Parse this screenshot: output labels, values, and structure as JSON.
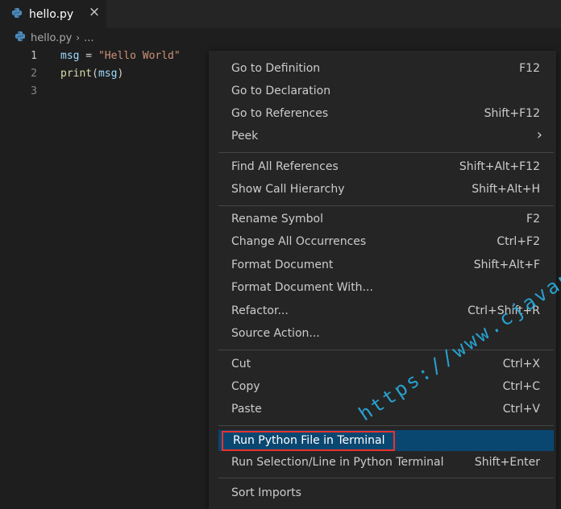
{
  "tab": {
    "filename": "hello.py",
    "close_icon": "×"
  },
  "breadcrumb": {
    "file": "hello.py",
    "separator": "›",
    "more": "..."
  },
  "editor": {
    "line_numbers": [
      "1",
      "2",
      "3"
    ],
    "line1": {
      "var": "msg",
      "op": " = ",
      "str": "\"Hello World\""
    },
    "line2": {
      "fn": "print",
      "open": "(",
      "var": "msg",
      "close": ")"
    }
  },
  "menu": {
    "go_to_definition": {
      "label": "Go to Definition",
      "shortcut": "F12"
    },
    "go_to_declaration": {
      "label": "Go to Declaration",
      "shortcut": ""
    },
    "go_to_references": {
      "label": "Go to References",
      "shortcut": "Shift+F12"
    },
    "peek": {
      "label": "Peek",
      "submenu_icon": "›"
    },
    "find_all_references": {
      "label": "Find All References",
      "shortcut": "Shift+Alt+F12"
    },
    "show_call_hierarchy": {
      "label": "Show Call Hierarchy",
      "shortcut": "Shift+Alt+H"
    },
    "rename_symbol": {
      "label": "Rename Symbol",
      "shortcut": "F2"
    },
    "change_all_occurrences": {
      "label": "Change All Occurrences",
      "shortcut": "Ctrl+F2"
    },
    "format_document": {
      "label": "Format Document",
      "shortcut": "Shift+Alt+F"
    },
    "format_document_with": {
      "label": "Format Document With...",
      "shortcut": ""
    },
    "refactor": {
      "label": "Refactor...",
      "shortcut": "Ctrl+Shift+R"
    },
    "source_action": {
      "label": "Source Action...",
      "shortcut": ""
    },
    "cut": {
      "label": "Cut",
      "shortcut": "Ctrl+X"
    },
    "copy": {
      "label": "Copy",
      "shortcut": "Ctrl+C"
    },
    "paste": {
      "label": "Paste",
      "shortcut": "Ctrl+V"
    },
    "run_python_file_in_terminal": {
      "label": "Run Python File in Terminal",
      "shortcut": ""
    },
    "run_selection_line": {
      "label": "Run Selection/Line in Python Terminal",
      "shortcut": "Shift+Enter"
    },
    "sort_imports": {
      "label": "Sort Imports",
      "shortcut": ""
    }
  },
  "watermark": {
    "text": "https://www.cjavapy.com"
  },
  "colors": {
    "editor_bg": "#1e1e1e",
    "menu_bg": "#252526",
    "selection_bg": "#094771",
    "highlight_border": "#e8322c",
    "watermark": "#29a8d8"
  },
  "icons": {
    "file_icon": "python-icon",
    "close": "close-icon",
    "submenu": "chevron-right-icon"
  }
}
